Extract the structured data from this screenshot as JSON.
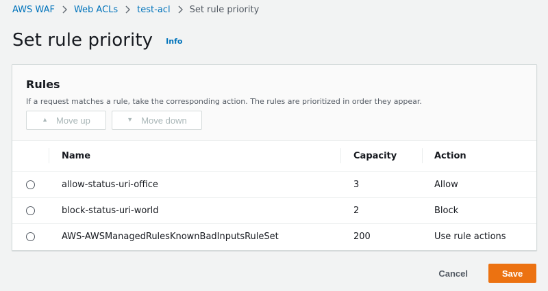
{
  "breadcrumb": {
    "items": [
      "AWS WAF",
      "Web ACLs",
      "test-acl"
    ],
    "current": "Set rule priority"
  },
  "header": {
    "title": "Set rule priority",
    "info_label": "Info"
  },
  "rules_panel": {
    "title": "Rules",
    "description": "If a request matches a rule, take the corresponding action. The rules are prioritized in order they appear.",
    "move_up_label": "Move up",
    "move_down_label": "Move down",
    "columns": [
      "Name",
      "Capacity",
      "Action"
    ],
    "rows": [
      {
        "name": "allow-status-uri-office",
        "capacity": "3",
        "action": "Allow"
      },
      {
        "name": "block-status-uri-world",
        "capacity": "2",
        "action": "Block"
      },
      {
        "name": "AWS-AWSManagedRulesKnownBadInputsRuleSet",
        "capacity": "200",
        "action": "Use rule actions"
      }
    ]
  },
  "footer": {
    "cancel_label": "Cancel",
    "save_label": "Save"
  },
  "colors": {
    "link": "#0073bb",
    "primary_button": "#ec7211",
    "background": "#f2f3f3"
  },
  "icons": {
    "breadcrumb_separator": "chevron-right-icon",
    "move_up": "triangle-up-icon",
    "move_down": "triangle-down-icon"
  }
}
